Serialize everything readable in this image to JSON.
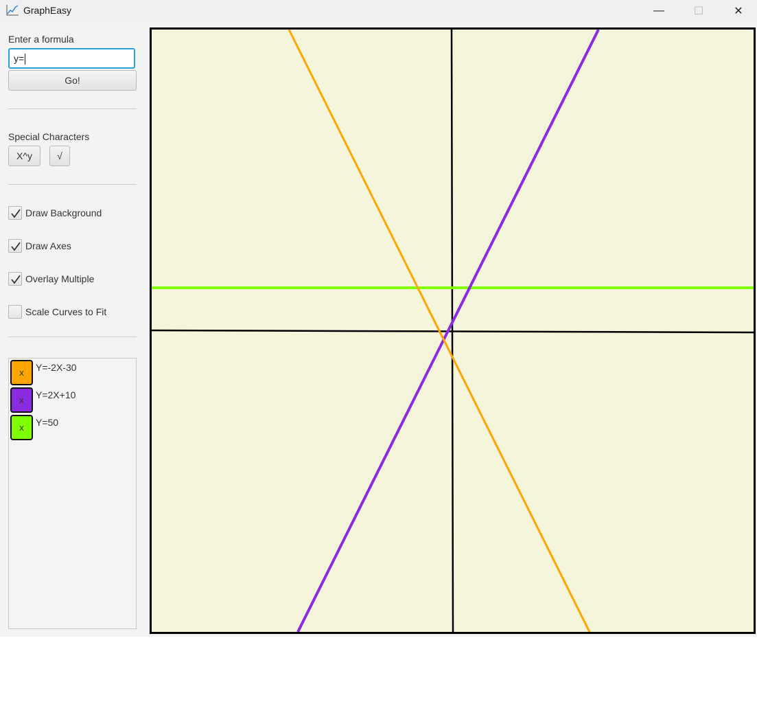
{
  "window": {
    "title": "GraphEasy",
    "min_glyph": "—",
    "max_glyph": "☐",
    "close_glyph": "✕"
  },
  "sidebar": {
    "formula_label": "Enter a formula",
    "formula_value": "y=",
    "go_label": "Go!",
    "special_label": "Special Characters",
    "special_buttons": [
      "X^y",
      "√"
    ],
    "options": [
      {
        "label": "Draw Background",
        "checked": true
      },
      {
        "label": "Draw Axes",
        "checked": true
      },
      {
        "label": "Overlay Multiple",
        "checked": true
      },
      {
        "label": "Scale Curves to Fit",
        "checked": false
      }
    ],
    "curves": [
      {
        "formula": "Y=-2X-30",
        "color": "#FFA500",
        "remove_label": "x"
      },
      {
        "formula": "Y=2X+10",
        "color": "#8A2BE2",
        "remove_label": "x"
      },
      {
        "formula": "Y=50",
        "color": "#7FFF00",
        "remove_label": "x"
      }
    ]
  },
  "graph": {
    "background_color": "#F5F5DC",
    "axis_color": "#000000"
  }
}
